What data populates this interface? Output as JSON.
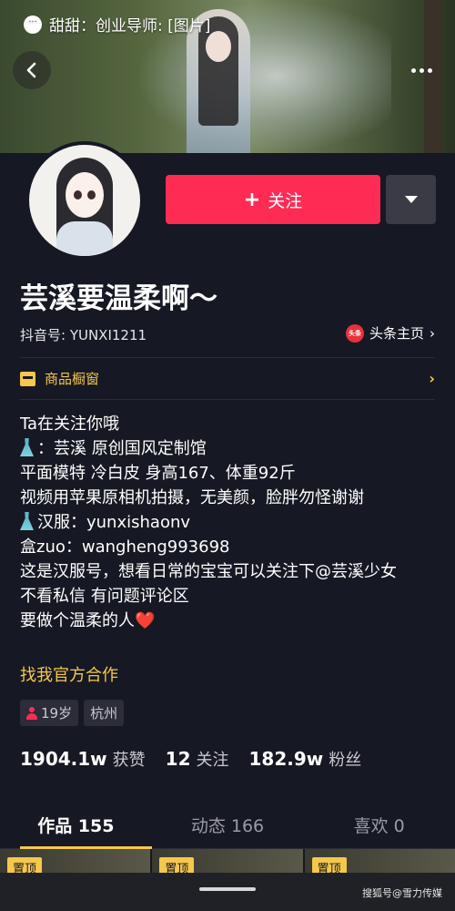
{
  "notification": {
    "text": "甜甜：创业导师: [图片]"
  },
  "profile": {
    "name": "芸溪要温柔啊～",
    "douyin_id": "抖音号: YUNXI1211",
    "toutiao_logo_text": "头条",
    "toutiao_label": "头条主页"
  },
  "actions": {
    "follow_label": "关注",
    "follow_plus": "+"
  },
  "shop": {
    "label": "商品橱窗"
  },
  "bio": {
    "line1": "Ta在关注你哦",
    "line2": "：芸溪 原创国风定制馆",
    "line3": "平面模特 冷白皮 身高167、体重92斤",
    "line4": "视频用苹果原相机拍摄，无美颜，脸胖勿怪谢谢",
    "line5": "汉服：yunxishaonv",
    "line6": "盒zuo：wangheng993698",
    "line7": "这是汉服号，想看日常的宝宝可以关注下@芸溪少女",
    "line8": "不看私信 有问题评论区",
    "line9": "要做个温柔的人",
    "heart": "❤️",
    "coop_link": "找我官方合作"
  },
  "tags": {
    "age": "19岁",
    "city": "杭州"
  },
  "stats": {
    "likes_num": "1904.1w",
    "likes_label": "获赞",
    "following_num": "12",
    "following_label": "关注",
    "fans_num": "182.9w",
    "fans_label": "粉丝"
  },
  "tabs": [
    {
      "label": "作品 155"
    },
    {
      "label": "动态 166"
    },
    {
      "label": "喜欢 0"
    }
  ],
  "thumbnails": {
    "pin_label": "置顶"
  },
  "watermark": "搜狐号@雪力传媒",
  "colors": {
    "accent": "#fe2c55",
    "gold": "#f5c84c",
    "background": "#161823"
  },
  "icons": [
    "back-arrow-icon",
    "more-dots-icon",
    "dropdown-triangle-icon",
    "shop-icon",
    "chevron-right-icon",
    "dress-icon",
    "person-icon",
    "chat-bubble-icon"
  ]
}
